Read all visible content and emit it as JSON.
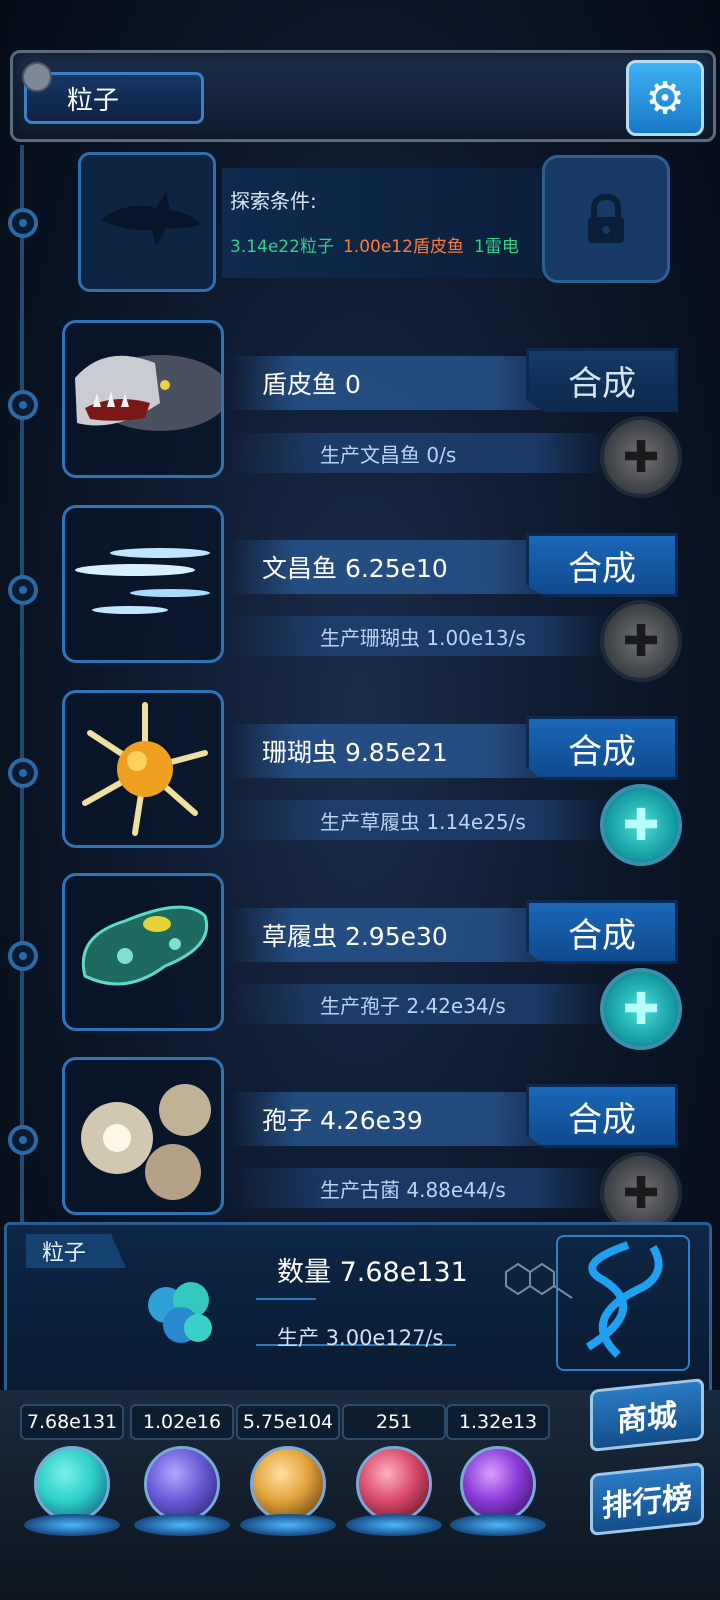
{
  "header": {
    "title": "粒子",
    "settings_icon": "gear-icon"
  },
  "locked_creature": {
    "label": "探索条件:",
    "conditions": [
      {
        "text": "3.14e22粒子",
        "color": "#35d08a"
      },
      {
        "text": "1.00e12盾皮鱼",
        "color": "#ff7a3a"
      },
      {
        "text": "1雷电",
        "color": "#35d08a"
      }
    ],
    "lock_icon": "lock-icon",
    "silhouette_icon": "shark-silhouette-icon"
  },
  "creatures": [
    {
      "name": "盾皮鱼 0",
      "production": "生产文昌鱼 0/s",
      "synth_label": "合成",
      "plus_active": false,
      "image_icon": "armored-fish-icon"
    },
    {
      "name": "文昌鱼 6.25e10",
      "production": "生产珊瑚虫 1.00e13/s",
      "synth_label": "合成",
      "plus_active": false,
      "image_icon": "lancelet-icon"
    },
    {
      "name": "珊瑚虫 9.85e21",
      "production": "生产草履虫 1.14e25/s",
      "synth_label": "合成",
      "plus_active": true,
      "image_icon": "coral-polyp-icon"
    },
    {
      "name": "草履虫 2.95e30",
      "production": "生产孢子 2.42e34/s",
      "synth_label": "合成",
      "plus_active": true,
      "image_icon": "paramecium-icon"
    },
    {
      "name": "孢子 4.26e39",
      "production": "生产古菌 4.88e44/s",
      "synth_label": "合成",
      "plus_active": false,
      "image_icon": "spore-icon"
    }
  ],
  "bottom_panel": {
    "tag": "粒子",
    "count": "数量 7.68e131",
    "production": "生产 3.00e127/s",
    "dna_icon": "dna-icon",
    "molecule_icon": "molecule-icon",
    "particle_icon": "particle-cluster-icon"
  },
  "resources": [
    {
      "value": "7.68e131",
      "icon": "particle-orb-icon",
      "color": "#2fd0c8"
    },
    {
      "value": "1.02e16",
      "icon": "lightning-orb-icon",
      "color": "#6a5ad8"
    },
    {
      "value": "5.75e104",
      "icon": "galaxy-orb-icon",
      "color": "#e2a23a"
    },
    {
      "value": "251",
      "icon": "brain-orb-icon",
      "color": "#d84a6a"
    },
    {
      "value": "1.32e13",
      "icon": "vortex-orb-icon",
      "color": "#8a3ad8"
    }
  ],
  "side_buttons": {
    "shop": "商城",
    "leaderboard": "排行榜"
  },
  "colors": {
    "accent_blue": "#1b67b8",
    "frame_blue": "#2f73b8",
    "active_plus": "#49e0d8"
  }
}
